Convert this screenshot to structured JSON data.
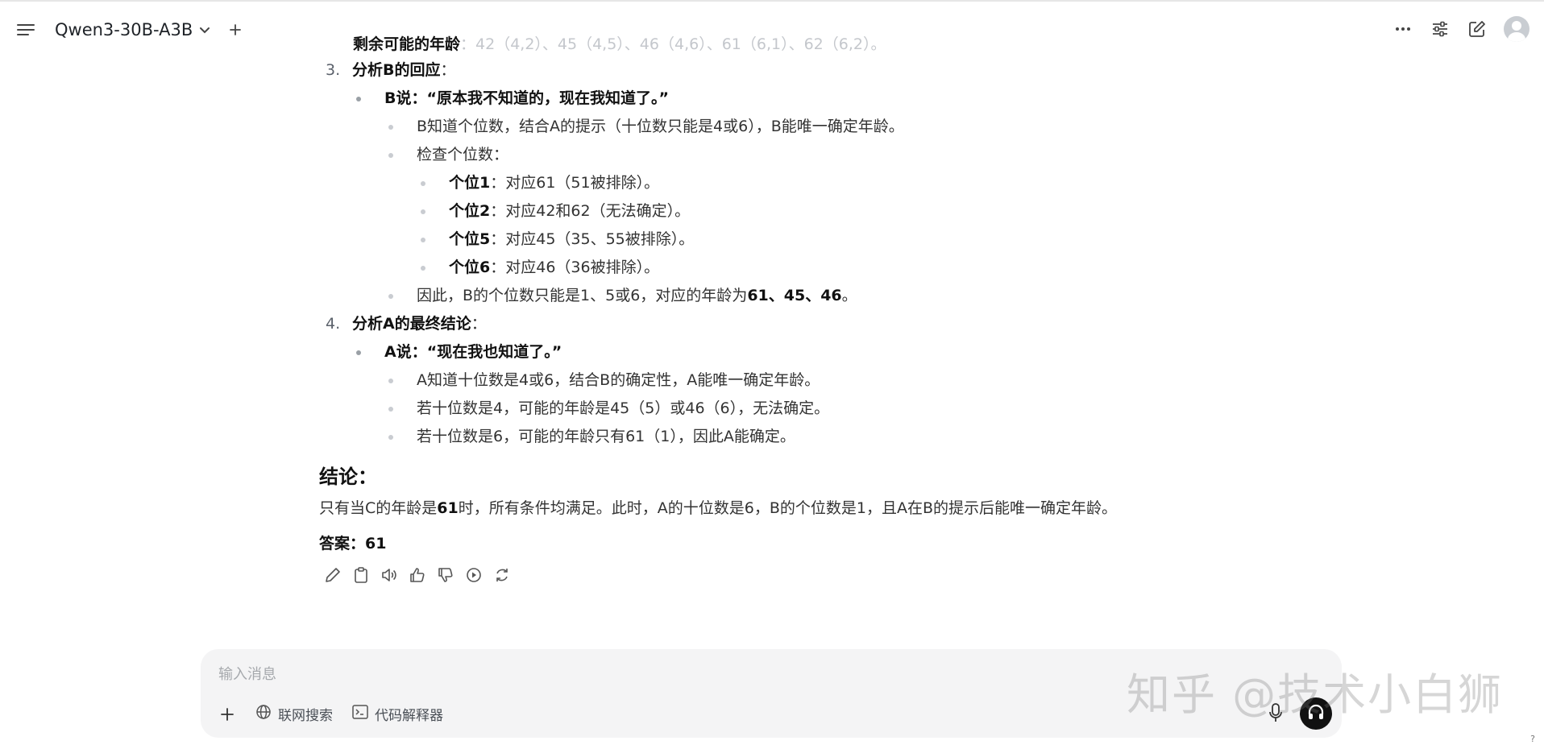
{
  "header": {
    "model_name": "Qwen3-30B-A3B",
    "icons": [
      "menu-icon",
      "chevron-down-icon",
      "plus-icon",
      "more-icon",
      "sliders-icon",
      "edit-icon",
      "avatar"
    ]
  },
  "scrolled_line": {
    "label": "剩余可能的年龄",
    "text": "：42（4,2）、45（4,5）、46（4,6）、61（6,1）、62（6,2）。"
  },
  "steps": [
    {
      "number": "3.",
      "title": "分析B的回应",
      "colon": "：",
      "quote": "B说：“原本我不知道的，现在我知道了。”",
      "items": [
        {
          "text": "B知道个位数，结合A的提示（十位数只能是4或6），B能唯一确定年龄。"
        },
        {
          "text": "检查个位数："
        }
      ],
      "digits": [
        {
          "label": "个位1",
          "text": "：对应61（51被排除）。"
        },
        {
          "label": "个位2",
          "text": "：对应42和62（无法确定）。"
        },
        {
          "label": "个位5",
          "text": "：对应45（35、55被排除）。"
        },
        {
          "label": "个位6",
          "text": "：对应46（36被排除）。"
        }
      ],
      "therefore_prefix": "因此，B的个位数只能是1、5或6，对应的年龄为",
      "therefore_bold": "61、45、46",
      "therefore_suffix": "。"
    },
    {
      "number": "4.",
      "title": "分析A的最终结论",
      "colon": "：",
      "quote": "A说：“现在我也知道了。”",
      "items": [
        {
          "text": "A知道十位数是4或6，结合B的确定性，A能唯一确定年龄。"
        },
        {
          "text": "若十位数是4，可能的年龄是45（5）或46（6），无法确定。"
        },
        {
          "text": "若十位数是6，可能的年龄只有61（1），因此A能确定。"
        }
      ]
    }
  ],
  "conclusion": {
    "heading": "结论：",
    "prefix": "只有当C的年龄是",
    "bold": "61",
    "suffix": "时，所有条件均满足。此时，A的十位数是6，B的个位数是1，且A在B的提示后能唯一确定年龄。"
  },
  "answer": "答案：61",
  "actions": [
    "edit-icon",
    "copy-icon",
    "speaker-icon",
    "thumbs-up-icon",
    "thumbs-down-icon",
    "play-icon",
    "regenerate-icon"
  ],
  "composer": {
    "placeholder": "输入消息",
    "web_search": "联网搜索",
    "code_interpreter": "代码解释器"
  },
  "watermark": "知乎 @技术小白狮",
  "help": "?"
}
